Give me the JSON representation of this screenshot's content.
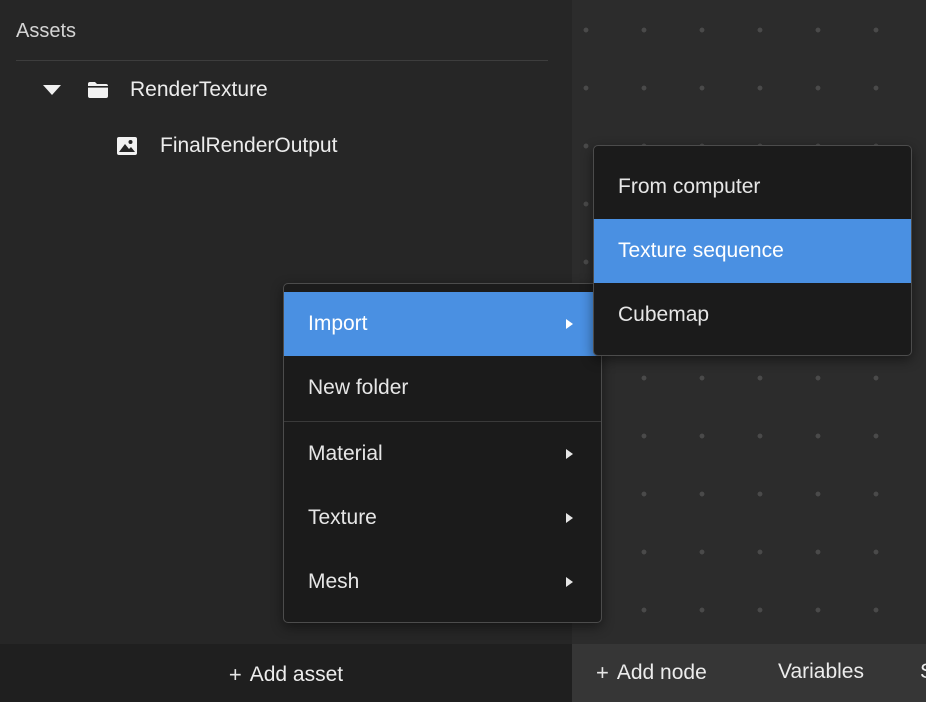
{
  "assets_panel": {
    "title": "Assets",
    "tree": {
      "folder": {
        "label": "RenderTexture",
        "icon": "folder-icon",
        "expanded": true
      },
      "file": {
        "label": "FinalRenderOutput",
        "icon": "image-icon"
      }
    },
    "add_asset_label": "Add asset",
    "plus": "+"
  },
  "canvas_toolbar": {
    "plus": "+",
    "add_node_label": "Add node",
    "variables_label": "Variables",
    "cut_label": "S"
  },
  "context_menu": {
    "items": [
      {
        "label": "Import",
        "has_submenu": true,
        "active": true
      },
      {
        "label": "New folder",
        "has_submenu": false,
        "active": false
      },
      {
        "label": "Material",
        "has_submenu": true,
        "active": false
      },
      {
        "label": "Texture",
        "has_submenu": true,
        "active": false
      },
      {
        "label": "Mesh",
        "has_submenu": true,
        "active": false
      }
    ]
  },
  "import_submenu": {
    "items": [
      {
        "label": "From computer",
        "active": false
      },
      {
        "label": "Texture sequence",
        "active": true
      },
      {
        "label": "Cubemap",
        "active": false
      }
    ]
  },
  "colors": {
    "accent": "#4a90e2",
    "menu_bg": "#1b1b1b",
    "panel_bg": "#262626",
    "canvas_bg": "#2c2c2c"
  }
}
